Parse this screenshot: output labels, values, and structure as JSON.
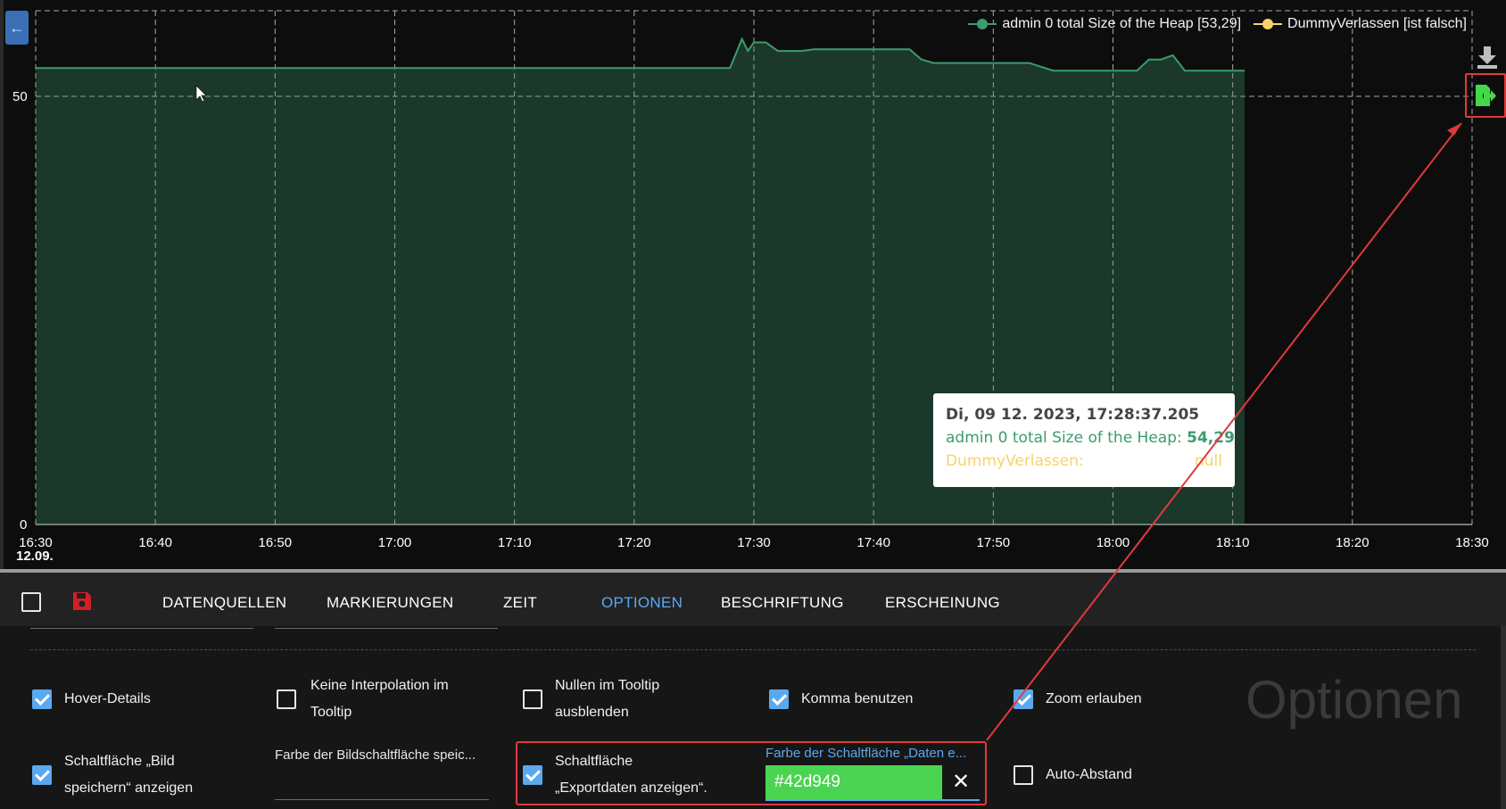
{
  "chart": {
    "legend": [
      {
        "name": "admin 0 total Size of the Heap [53,29]",
        "color": "#3c9c6d"
      },
      {
        "name": "DummyVerlassen [ist falsch]",
        "color": "#f5d36b"
      }
    ],
    "y_ticks": [
      "50",
      "0"
    ],
    "x_ticks": [
      "16:30",
      "16:40",
      "16:50",
      "17:00",
      "17:10",
      "17:20",
      "17:30",
      "17:40",
      "17:50",
      "18:00",
      "18:10",
      "18:20",
      "18:30"
    ],
    "x_date": "12.09.",
    "tooltip": {
      "title": "Di, 09 12. 2023, 17:28:37.205",
      "series1_label": "admin 0 total Size of the Heap: ",
      "series1_value": "54,29",
      "series2_label": "DummyVerlassen:",
      "series2_value": "null"
    },
    "icons": {
      "back": "arrow-left-icon",
      "download": "download-icon",
      "export": "export-icon"
    }
  },
  "chart_data": {
    "type": "area",
    "title": "",
    "xlabel": "",
    "ylabel": "",
    "ylim": [
      0,
      60
    ],
    "x_range": [
      "16:30",
      "18:30"
    ],
    "grid": true,
    "legend_placement": "top-right",
    "series": [
      {
        "name": "admin 0 total Size of the Heap [53,29]",
        "color": "#3c9c6d",
        "x": [
          "16:30",
          "17:28",
          "17:29",
          "17:29.5",
          "17:30",
          "17:31",
          "17:32",
          "17:34",
          "17:35",
          "17:38",
          "17:40",
          "17:43",
          "17:44",
          "17:45",
          "17:50",
          "17:53",
          "17:55",
          "17:58",
          "18:02",
          "18:03",
          "18:04",
          "18:05",
          "18:06",
          "18:11"
        ],
        "values": [
          53.3,
          53.3,
          56.7,
          55.3,
          56.3,
          56.3,
          55.3,
          55.3,
          55.5,
          55.5,
          55.5,
          55.5,
          54.3,
          53.9,
          53.9,
          53.9,
          53.0,
          53.0,
          53.0,
          54.3,
          54.3,
          54.8,
          53.0,
          53.0
        ]
      },
      {
        "name": "DummyVerlassen [ist falsch]",
        "color": "#f5d36b",
        "x": [],
        "values": []
      }
    ]
  },
  "toolbar": {
    "tabs": [
      "DATENQUELLEN",
      "MARKIERUNGEN",
      "ZEIT",
      "OPTIONEN",
      "BESCHRIFTUNG",
      "ERSCHEINUNG"
    ],
    "active_tab": "OPTIONEN",
    "save_icon": "save-icon",
    "accent": "#5aa9ef",
    "save_color": "#d21f26"
  },
  "options": {
    "watermark": "Optionen",
    "hover_details": {
      "label": "Hover-Details",
      "checked": true
    },
    "no_interpolation": {
      "line1": "Keine Interpolation im",
      "line2": "Tooltip",
      "checked": false
    },
    "hide_nulls": {
      "line1": "Nullen im Tooltip",
      "line2": "ausblenden",
      "checked": false
    },
    "use_comma": {
      "label": "Komma benutzen",
      "checked": true
    },
    "allow_zoom": {
      "label": "Zoom erlauben",
      "checked": true
    },
    "save_image_button": {
      "line1": "Schaltfläche „Bild",
      "line2": "speichern“ anzeigen",
      "checked": true
    },
    "image_button_color_label": "Farbe der Bildschaltfläche speic...",
    "export_button": {
      "line1": "Schaltfläche",
      "line2": "„Exportdaten anzeigen“.",
      "checked": true
    },
    "export_color_label": "Farbe der Schaltfläche „Daten e...",
    "export_color_value": "#42d949",
    "auto_spacing": {
      "label": "Auto-Abstand",
      "checked": false
    }
  }
}
